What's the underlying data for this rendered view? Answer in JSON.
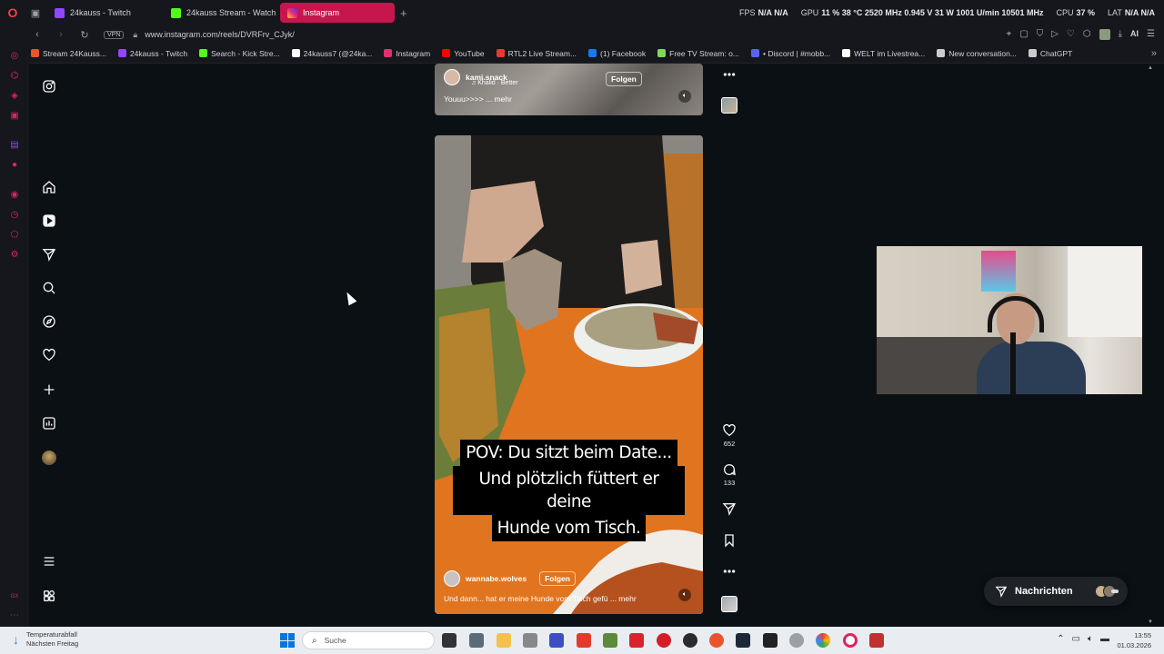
{
  "browser": {
    "tabs": [
      {
        "label": "24kauss - Twitch",
        "active": false
      },
      {
        "label": "24kauss Stream - Watch L",
        "active": false
      },
      {
        "label": "Instagram",
        "active": true
      }
    ],
    "url": "www.instagram.com/reels/DVRFrv_CJyk/",
    "vpn_label": "VPN",
    "ai_label": "AI"
  },
  "hw_stats": {
    "fps_label": "FPS",
    "fps_value": "N/A N/A",
    "gpu_label": "GPU",
    "gpu_value": "11 % 38 °C 2520 MHz 0.945 V 31 W 1001 U/min 10501 MHz",
    "cpu_label": "CPU",
    "cpu_value": "37 %",
    "lat_label": "LAT",
    "lat_value": "N/A N/A"
  },
  "bookmarks": [
    {
      "label": "Stream 24Kauss...",
      "color": "#e8552d"
    },
    {
      "label": "24kauss - Twitch",
      "color": "#9146ff"
    },
    {
      "label": "Search - Kick Stre...",
      "color": "#53fc18"
    },
    {
      "label": "24kauss7 (@24ka...",
      "color": "#ffffff"
    },
    {
      "label": "Instagram",
      "color": "#e1306c"
    },
    {
      "label": "YouTube",
      "color": "#ff0000"
    },
    {
      "label": "RTL2 Live Stream...",
      "color": "#e63b2e"
    },
    {
      "label": "(1) Facebook",
      "color": "#1877f2"
    },
    {
      "label": "Free TV Stream: o...",
      "color": "#7ed957"
    },
    {
      "label": "• Discord | #mobb...",
      "color": "#5865f2"
    },
    {
      "label": "WELT im Livestrea...",
      "color": "#ffffff"
    },
    {
      "label": "New conversation...",
      "color": "#cccccc"
    },
    {
      "label": "ChatGPT",
      "color": "#cccccc"
    }
  ],
  "reels": {
    "top": {
      "username": "kami.snack",
      "music": "Khalid · Better",
      "follow_label": "Folgen",
      "caption": "Youuu>>>> ... mehr"
    },
    "main": {
      "username": "wannabe.wolves",
      "follow_label": "Folgen",
      "caption": "Und dann... hat er meine Hunde vom Tisch gefü ... mehr",
      "overlay_lines": [
        "POV: Du sitzt beim Date...",
        "Und plötzlich füttert er deine",
        "Hunde vom Tisch."
      ],
      "likes": "652",
      "comments": "133"
    }
  },
  "messages": {
    "label": "Nachrichten"
  },
  "taskbar": {
    "weather_title": "Temperaturabfall",
    "weather_sub": "Nächsten Freitag",
    "search_placeholder": "Suche",
    "time": "13:55",
    "date": "01.03.2026"
  },
  "icons": {
    "nav": [
      "instagram-icon",
      "home-icon",
      "reels-icon",
      "direct-icon",
      "search-icon",
      "explore-icon",
      "heart-icon",
      "create-icon",
      "dashboard-icon",
      "profile-avatar",
      "menu-icon",
      "apps-icon"
    ]
  }
}
